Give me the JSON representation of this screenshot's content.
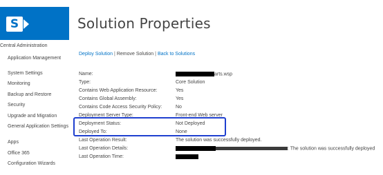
{
  "page_title": "Solution Properties",
  "colors": {
    "brand": "#0072c6",
    "highlight_border": "#1d3ecf",
    "text": "#444444"
  },
  "nav": {
    "header": "Central Administration",
    "items": [
      {
        "label": "Application Management"
      },
      {
        "label": "System Settings"
      },
      {
        "label": "Monitoring"
      },
      {
        "label": "Backup and Restore"
      },
      {
        "label": "Security"
      },
      {
        "label": "Upgrade and Migration"
      },
      {
        "label": "General Application Settings"
      },
      {
        "label": "Apps"
      },
      {
        "label": "Office 365"
      },
      {
        "label": "Configuration Wizards"
      }
    ]
  },
  "actions": {
    "deploy": "Deploy Solution",
    "remove": "Remove Solution",
    "back": "Back to Solutions",
    "separator": "|"
  },
  "properties": [
    {
      "label": "Name:",
      "value": "arts.wsp",
      "redacted": true
    },
    {
      "label": "Type:",
      "value": "Core Solution"
    },
    {
      "label": "Contains Web Application Resource:",
      "value": "Yes"
    },
    {
      "label": "Contains Global Assembly:",
      "value": "Yes"
    },
    {
      "label": "Contains Code Access Security Policy:",
      "value": "No"
    },
    {
      "label": "Deployment Server Type:",
      "value": "Front-end Web server",
      "obscured": true
    },
    {
      "label": "Deployment Status:",
      "value": "Not Deployed"
    },
    {
      "label": "Deployed To:",
      "value": "None"
    },
    {
      "label": "Last Operation Result:",
      "value": "The solution was successfully deployed.",
      "obscured": true
    },
    {
      "label": "Last Operation Details:",
      "value": ": The solution was successfully deployed",
      "redacted": true
    },
    {
      "label": "Last Operation Time:",
      "value": "",
      "redacted": true
    }
  ]
}
